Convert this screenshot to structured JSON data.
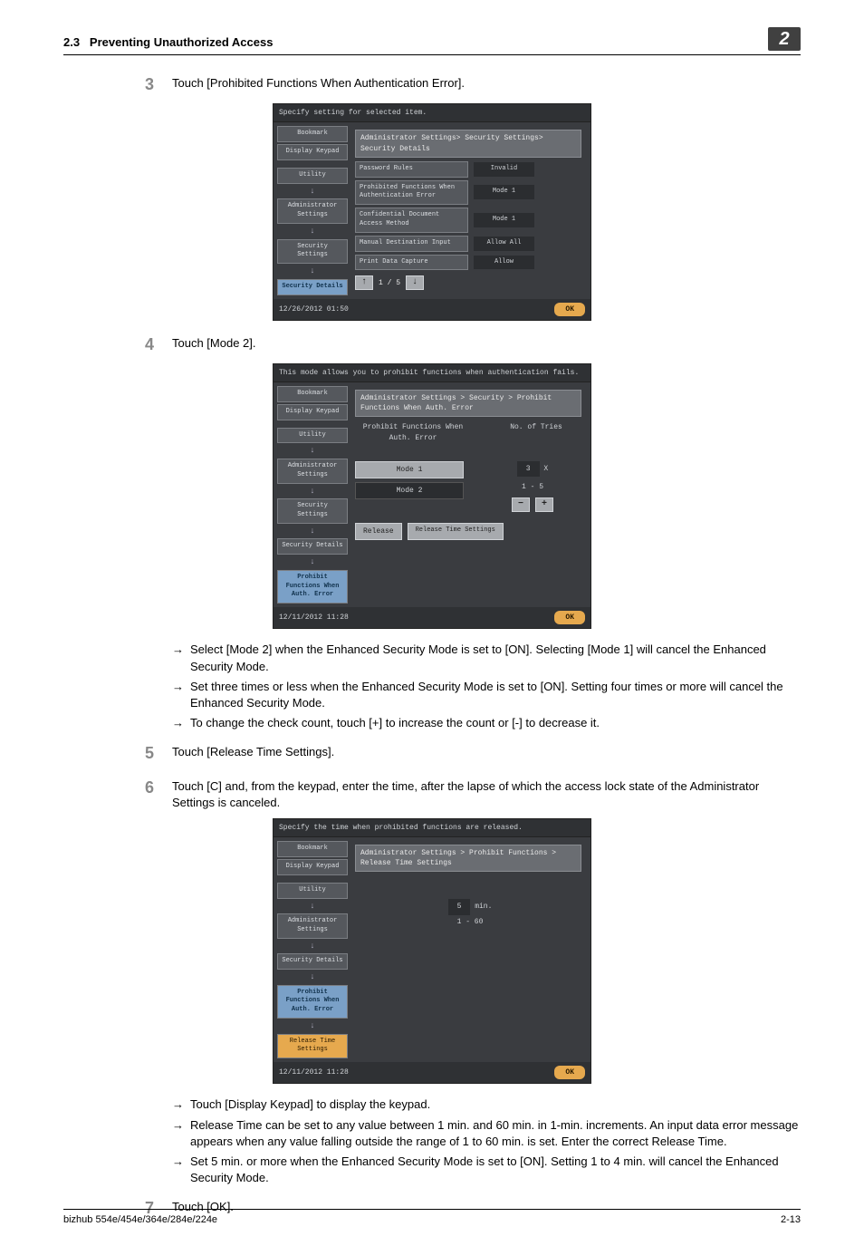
{
  "header": {
    "section_no": "2.3",
    "section_title": "Preventing Unauthorized Access",
    "chapter_num": "2"
  },
  "steps": {
    "s3": {
      "num": "3",
      "text": "Touch [Prohibited Functions When Authentication Error]."
    },
    "s4": {
      "num": "4",
      "text": "Touch [Mode 2]."
    },
    "s5": {
      "num": "5",
      "text": "Touch [Release Time Settings]."
    },
    "s6": {
      "num": "6",
      "text": "Touch [C] and, from the keypad, enter the time, after the lapse of which the access lock state of the Administrator Settings is canceled."
    },
    "s7": {
      "num": "7",
      "text": "Touch [OK]."
    }
  },
  "bullets_a": {
    "b1": "Select [Mode 2] when the Enhanced Security Mode is set to [ON]. Selecting [Mode 1] will cancel the Enhanced Security Mode.",
    "b2": "Set three times or less when the Enhanced Security Mode is set to [ON]. Setting four times or more will cancel the Enhanced Security Mode.",
    "b3": "To change the check count, touch [+] to increase the count or [-] to decrease it."
  },
  "bullets_b": {
    "b1": "Touch [Display Keypad] to display the keypad.",
    "b2": "Release Time can be set to any value between 1 min. and 60 min. in 1-min. increments. An input data error message appears when any value falling outside the range of 1 to 60 min. is set. Enter the correct Release Time.",
    "b3": "Set 5 min. or more when the Enhanced Security Mode is set to [ON]. Setting 1 to 4 min. will cancel the Enhanced Security Mode."
  },
  "shot1": {
    "title": "Specify setting for selected item.",
    "breadcrumb": "Administrator Settings> Security Settings> Security Details",
    "sidebar": [
      "Bookmark",
      "Display Keypad",
      "Utility",
      "Administrator Settings",
      "Security Settings",
      "Security Details"
    ],
    "rows": [
      {
        "label": "Password Rules",
        "value": "Invalid"
      },
      {
        "label": "Prohibited Functions When Authentication Error",
        "value": "Mode 1"
      },
      {
        "label": "Confidential Document Access Method",
        "value": "Mode 1"
      },
      {
        "label": "Manual Destination Input",
        "value": "Allow All"
      },
      {
        "label": "Print Data Capture",
        "value": "Allow"
      }
    ],
    "pager": "1 / 5",
    "timestamp": "12/26/2012   01:50",
    "ok": "OK"
  },
  "shot2": {
    "title": "This mode allows you to prohibit functions when authentication fails.",
    "breadcrumb": "Administrator Settings > Security > Prohibit Functions When Auth. Error",
    "sidebar": [
      "Bookmark",
      "Display Keypad",
      "Utility",
      "Administrator Settings",
      "Security Settings",
      "Security Details",
      "Prohibit Functions When Auth. Error"
    ],
    "col_left_label": "Prohibit Functions When Auth. Error",
    "col_right_label": "No. of Tries",
    "mode1": "Mode 1",
    "mode2": "Mode 2",
    "tries_value": "3",
    "tries_unit": "X",
    "tries_range": "1  -  5",
    "minus": "−",
    "plus": "+",
    "release": "Release",
    "release_time": "Release Time Settings",
    "timestamp": "12/11/2012   11:28",
    "ok": "OK"
  },
  "shot3": {
    "title": "Specify the time when prohibited functions are released.",
    "breadcrumb": "Administrator Settings > Prohibit Functions > Release Time Settings",
    "sidebar": [
      "Bookmark",
      "Display Keypad",
      "Utility",
      "Administrator Settings",
      "Security Details",
      "Prohibit Functions When Auth. Error",
      "Release Time Settings"
    ],
    "value": "5",
    "unit": "min.",
    "range": "1  -  60",
    "timestamp": "12/11/2012   11:28",
    "ok": "OK"
  },
  "footer": {
    "left": "bizhub 554e/454e/364e/284e/224e",
    "right": "2-13"
  }
}
